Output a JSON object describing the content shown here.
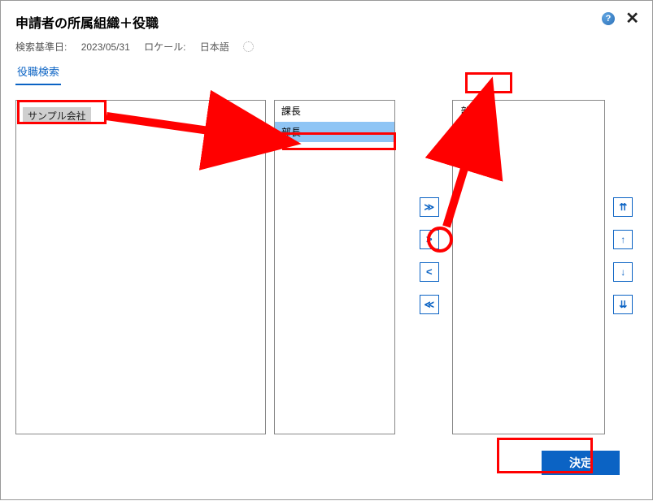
{
  "header": {
    "title": "申請者の所属組織＋役職"
  },
  "sub": {
    "date_label": "検索基準日:",
    "date_value": "2023/05/31",
    "locale_label": "ロケール:",
    "locale_value": "日本語"
  },
  "tabs": {
    "active": "役職検索"
  },
  "tree": {
    "selected": "サンプル会社"
  },
  "list": {
    "items": [
      "課長",
      "部長"
    ],
    "selected_index": 1
  },
  "selected": {
    "items": [
      "部長"
    ]
  },
  "mid_buttons": [
    "≫",
    ">",
    "<",
    "≪"
  ],
  "order_buttons": [
    "⇈",
    "↑",
    "↓",
    "⇊"
  ],
  "footer": {
    "confirm": "決定"
  }
}
